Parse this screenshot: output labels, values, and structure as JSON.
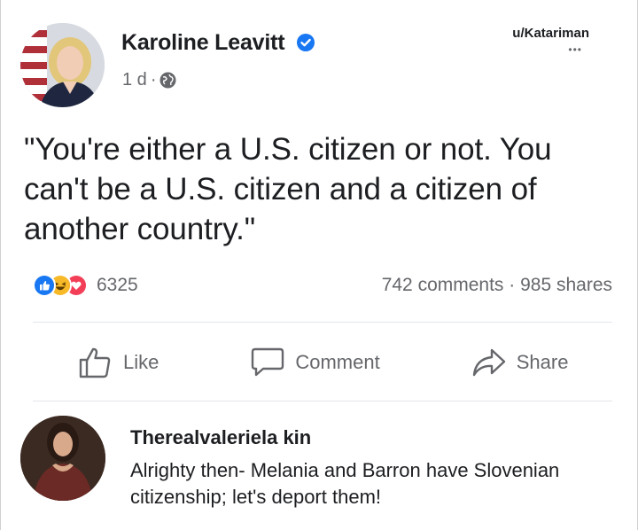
{
  "post": {
    "author": "Karoline Leavitt",
    "time": "1 d",
    "username_tag": "u/Katariman",
    "more_label": "•••",
    "text": "\"You're either a U.S. citizen or not. You can't be a U.S. citizen and a citizen of another country.\""
  },
  "stats": {
    "reaction_count": "6325",
    "comments_shares": "742 comments · 985 shares",
    "reactions": [
      "like-icon",
      "haha-icon",
      "love-icon"
    ]
  },
  "actions": {
    "like_label": "Like",
    "comment_label": "Comment",
    "share_label": "Share"
  },
  "comment": {
    "author": "Therealvaleriela kin",
    "text": "Alrighty then- Melania and Barron have Slovenian citizenship; let's deport them!"
  },
  "colors": {
    "verified": "#1877f2",
    "like": "#1877f2",
    "haha": "#f7b928",
    "love": "#f33e58",
    "secondary_text": "#65676b"
  }
}
